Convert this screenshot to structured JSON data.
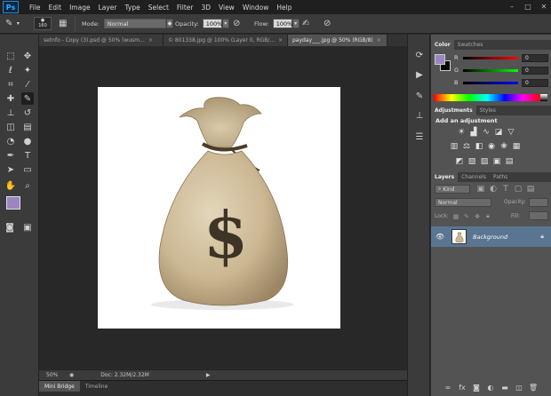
{
  "app": {
    "logo_text": "Ps"
  },
  "menu": [
    "File",
    "Edit",
    "Image",
    "Layer",
    "Type",
    "Select",
    "Filter",
    "3D",
    "View",
    "Window",
    "Help"
  ],
  "window_buttons": [
    "–",
    "□",
    "✕"
  ],
  "options": {
    "brush_size": "160",
    "mode_label": "Mode:",
    "mode_value": "Normal",
    "opacity_label": "Opacity:",
    "opacity_value": "100%",
    "flow_label": "Flow:",
    "flow_value": "100%"
  },
  "doc_tabs": [
    {
      "label": "setnfo - Copy (3).psd @ 50% (wusm...",
      "active": false
    },
    {
      "label": "© 801338.jpg @ 100% (Layer 0, RGB/...",
      "active": false
    },
    {
      "label": "payday___.jpg @ 50% (RGB/8)",
      "active": true
    }
  ],
  "status": {
    "zoom": "50%",
    "doc_info": "Doc: 2.32M/2.32M"
  },
  "bottom_tabs": [
    {
      "label": "Mini Bridge",
      "active": true
    },
    {
      "label": "Timeline",
      "active": false
    }
  ],
  "color_panel": {
    "tabs": [
      "Color",
      "Swatches"
    ],
    "channels": [
      {
        "label": "R",
        "value": "0"
      },
      {
        "label": "G",
        "value": "0"
      },
      {
        "label": "B",
        "value": "0"
      }
    ],
    "foreground_color": "#9b86c2",
    "background_color": "#000000"
  },
  "adjustments_panel": {
    "tabs": [
      "Adjustments",
      "Styles"
    ],
    "heading": "Add an adjustment"
  },
  "layers_panel": {
    "tabs": [
      "Layers",
      "Channels",
      "Paths"
    ],
    "filter_kind": "Kind",
    "blend_mode": "Normal",
    "opacity_label": "Opacity:",
    "lock_label": "Lock:",
    "fill_label": "Fill:",
    "layers": [
      {
        "name": "Background",
        "visible": true,
        "locked": true
      }
    ]
  },
  "artwork": {
    "symbol": "$"
  },
  "colors": {
    "selection_blue": "#597591",
    "panel_bg": "#535353",
    "canvas_bg": "#282828"
  }
}
